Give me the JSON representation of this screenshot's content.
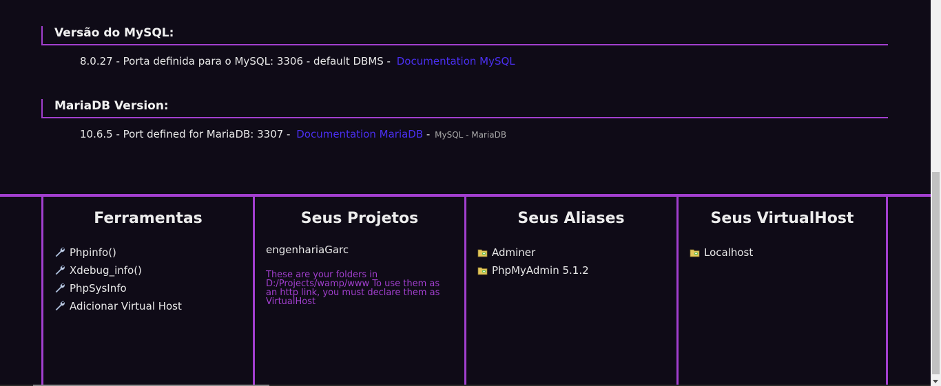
{
  "mysql": {
    "title": "Versão do MySQL:",
    "info": "8.0.27 - Porta definida para o MySQL: 3306 - default DBMS - ",
    "doc_link": "Documentation MySQL"
  },
  "mariadb": {
    "title": "MariaDB Version:",
    "info": "10.6.5 - Port defined for MariaDB: 3307 - ",
    "doc_link": "Documentation MariaDB",
    "separator": "-",
    "note": "MySQL - MariaDB"
  },
  "tools": {
    "title": "Ferramentas",
    "items": [
      "Phpinfo()",
      "Xdebug_info()",
      "PhpSysInfo",
      "Adicionar Virtual Host"
    ]
  },
  "projects": {
    "title": "Seus Projetos",
    "items": [
      "engenhariaGarc"
    ],
    "note": "These are your folders in D:/Projects/wamp/www To use them as an http link, you must declare them as VirtualHost"
  },
  "aliases": {
    "title": "Seus Aliases",
    "items": [
      "Adminer",
      "PhpMyAdmin 5.1.2"
    ]
  },
  "virtualhosts": {
    "title": "Seus VirtualHost",
    "items": [
      "Localhost"
    ]
  },
  "colors": {
    "background": "#0f0b17",
    "accent": "#a23fcf",
    "link": "#4a2ff0"
  }
}
